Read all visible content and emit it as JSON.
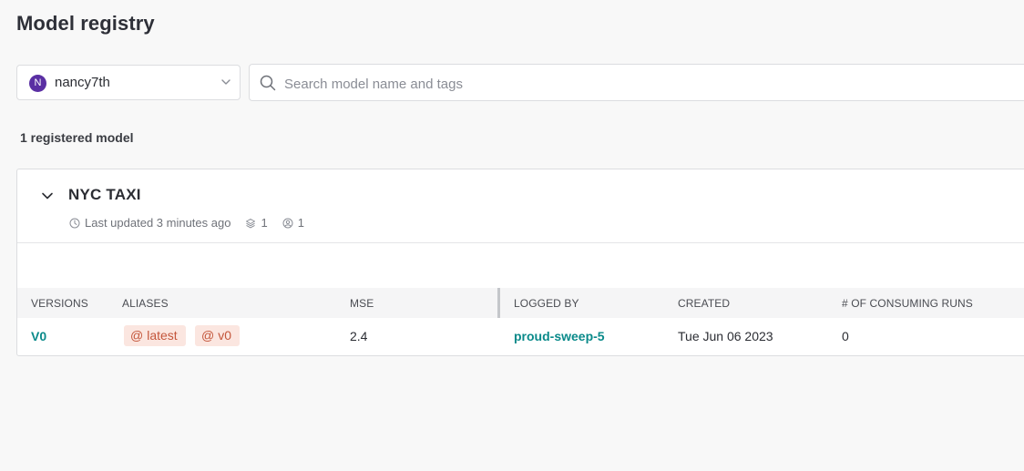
{
  "page": {
    "title": "Model registry"
  },
  "entity_selector": {
    "avatar_letter": "N",
    "value": "nancy7th",
    "avatar_color": "#5a2fa3"
  },
  "search": {
    "placeholder": "Search model name and tags",
    "value": ""
  },
  "registry": {
    "count_label": "1 registered model"
  },
  "model": {
    "name": "NYC TAXI",
    "last_updated": "Last updated 3 minutes ago",
    "versions_count": "1",
    "users_count": "1"
  },
  "table": {
    "headers": {
      "versions": "VERSIONS",
      "aliases": "ALIASES",
      "mse": "MSE",
      "logged_by": "LOGGED BY",
      "created": "CREATED",
      "consuming_runs": "# OF CONSUMING RUNS"
    },
    "rows": [
      {
        "version": "V0",
        "aliases": [
          "latest",
          "v0"
        ],
        "mse": "2.4",
        "logged_by": "proud-sweep-5",
        "created": "Tue Jun 06 2023",
        "consuming_runs": "0"
      }
    ]
  },
  "colors": {
    "link": "#0a8a8a",
    "alias_bg": "#fbe6e0",
    "alias_text": "#c4563b"
  },
  "icons": {
    "alias_symbol": "@",
    "dropdown": "chevron-down-icon",
    "search": "search-icon",
    "collapse": "chevron-down-icon",
    "clock": "clock-icon",
    "layers": "layers-icon",
    "user": "user-icon"
  }
}
